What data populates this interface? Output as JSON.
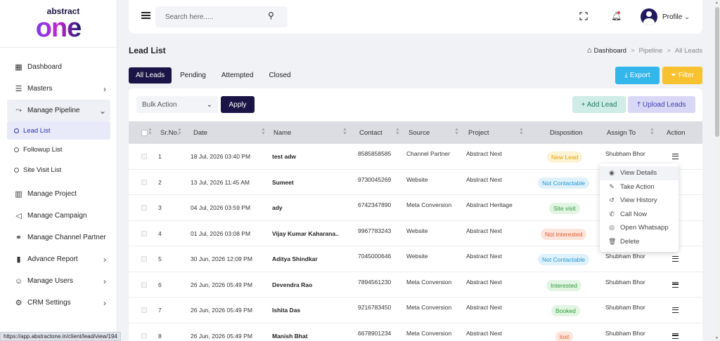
{
  "brand": {
    "small": "abstract",
    "big": "one"
  },
  "sidebar": {
    "items": [
      {
        "label": "Dashboard"
      },
      {
        "label": "Masters"
      },
      {
        "label": "Manage Pipeline"
      },
      {
        "label": "Manage Project"
      },
      {
        "label": "Manage Campaign"
      },
      {
        "label": "Manage Channel Partner"
      },
      {
        "label": "Advance Report"
      },
      {
        "label": "Manage Users"
      },
      {
        "label": "CRM Settings"
      }
    ],
    "pipeline_sub": [
      {
        "label": "Lead List"
      },
      {
        "label": "Followup List"
      },
      {
        "label": "Site Visit List"
      }
    ]
  },
  "header": {
    "search_placeholder": "Search here.....",
    "profile_label": "Profile"
  },
  "page": {
    "title": "Lead List"
  },
  "breadcrumb": {
    "home": "Dashboard",
    "parent": "Pipeline",
    "current": "All Leads",
    "separator": ">"
  },
  "tabs": [
    {
      "label": "All Leads"
    },
    {
      "label": "Pending"
    },
    {
      "label": "Attempted"
    },
    {
      "label": "Closed"
    }
  ],
  "toolbar": {
    "export_label": "Export",
    "filter_label": "Filter",
    "bulk_action_label": "Bulk Action",
    "apply_label": "Apply",
    "add_lead_label": "+ Add Lead",
    "upload_leads_label": "Upload Leads"
  },
  "table": {
    "columns": [
      "Sr.No.",
      "Date",
      "Name",
      "Contact",
      "Source",
      "Project",
      "Disposition",
      "Assign To",
      "Action"
    ],
    "rows": [
      {
        "sr": "1",
        "date": "18 Jul, 2026 03:40 PM",
        "name": "test adw",
        "contact": "8585858585",
        "source": "Channel Partner",
        "project": "Abstract Next",
        "disposition": "New Lead",
        "status": "new",
        "assign": "Shubham Bhor"
      },
      {
        "sr": "2",
        "date": "13 Jul, 2026 11:45 AM",
        "name": "Sumeet",
        "contact": "9730045269",
        "source": "Website",
        "project": "Abstract Next",
        "disposition": "Not Contactable",
        "status": "nc",
        "assign": ""
      },
      {
        "sr": "3",
        "date": "04 Jul, 2026 03:59 PM",
        "name": "ady",
        "contact": "6742347890",
        "source": "Meta Conversion",
        "project": "Abstract Heritage",
        "disposition": "Site visit",
        "status": "site",
        "assign": ""
      },
      {
        "sr": "4",
        "date": "01 Jul, 2026 03:08 PM",
        "name": "Vijay Kumar Kaharana..",
        "contact": "9967783243",
        "source": "Website",
        "project": "Abstract Next",
        "disposition": "Not Interested",
        "status": "ni",
        "assign": ""
      },
      {
        "sr": "5",
        "date": "30 Jun, 2026 12:09 PM",
        "name": "Aditya Shindkar",
        "contact": "7045000646",
        "source": "Website",
        "project": "Abstract Next",
        "disposition": "Not Contactable",
        "status": "nc",
        "assign": "Shubham Bhor"
      },
      {
        "sr": "6",
        "date": "26 Jun, 2026 05:49 PM",
        "name": "Devendra Rao",
        "contact": "7894561230",
        "source": "Meta Conversion",
        "project": "Abstract Next",
        "disposition": "Interested",
        "status": "int",
        "assign": "Shubham Bhor"
      },
      {
        "sr": "7",
        "date": "26 Jun, 2026 05:49 PM",
        "name": "Ishita Das",
        "contact": "9216783450",
        "source": "Meta Conversion",
        "project": "Abstract Next",
        "disposition": "Booked",
        "status": "book",
        "assign": "Shubham Bhor"
      },
      {
        "sr": "8",
        "date": "26 Jun, 2026 05:49 PM",
        "name": "Manish Bhat",
        "contact": "6678901234",
        "source": "Meta Conversion",
        "project": "Abstract Next",
        "disposition": "lost",
        "status": "lost",
        "assign": "Shubham Bhor"
      }
    ]
  },
  "action_menu": {
    "items": [
      {
        "label": "View Details",
        "icon": "eye-icon"
      },
      {
        "label": "Take Action",
        "icon": "edit-icon"
      },
      {
        "label": "View History",
        "icon": "history-icon"
      },
      {
        "label": "Call Now",
        "icon": "phone-icon"
      },
      {
        "label": "Open Whatsapp",
        "icon": "whatsapp-icon"
      },
      {
        "label": "Delete",
        "icon": "trash-icon"
      }
    ]
  },
  "statusbar": {
    "url": "https://app.abstractone.in/client/lead/view/194"
  },
  "colors": {
    "primary": "#1b1446",
    "export": "#33b6ea",
    "filter": "#f8c12f",
    "add": "#cfece7",
    "upload": "#d8d8f6"
  }
}
